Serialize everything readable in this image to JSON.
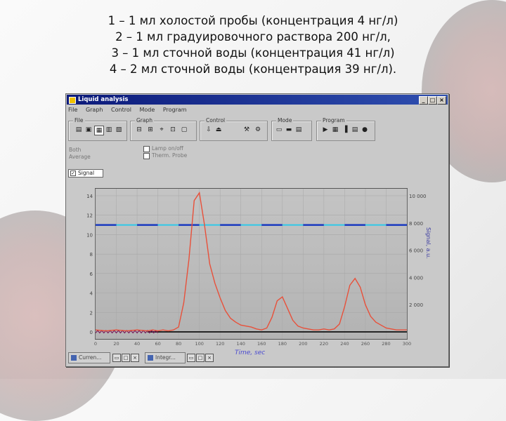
{
  "caption": [
    "1 – 1 мл холостой пробы (концентрация 4 нг/л)",
    "2 – 1 мл градуировочного раствора 200 нг/л,",
    "3 – 1 мл сточной воды (концентрация 41 нг/л)",
    "4 – 2 мл сточной воды (концентрация 39 нг/л)."
  ],
  "window": {
    "title": "Liquid analysis",
    "buttons": {
      "minimize": "_",
      "maximize": "□",
      "close": "×"
    },
    "menu": [
      "File",
      "Graph",
      "Control",
      "Mode",
      "Program"
    ],
    "toolbar_groups": {
      "file": "File",
      "graph": "Graph",
      "control": "Control",
      "mode": "Mode",
      "program": "Program"
    },
    "info_left": [
      "Both",
      "Average"
    ],
    "info_checks": [
      "Lamp on/off",
      "Therm. Probe"
    ],
    "series_select": "Signal"
  },
  "taskbar": [
    "Curren...",
    "Integr..."
  ],
  "chart_data": {
    "type": "line",
    "xlabel": "Time, sec",
    "ylabel_right": "Signal, a.u.",
    "x_ticks": [
      0,
      20,
      40,
      60,
      80,
      100,
      120,
      140,
      160,
      180,
      200,
      220,
      240,
      260,
      280,
      300
    ],
    "xlim": [
      0,
      300
    ],
    "y_left_ticks": [
      0,
      2,
      4,
      6,
      8,
      10,
      12,
      14
    ],
    "y_left_range": [
      0,
      14
    ],
    "y_right_ticks": [
      "2 000",
      "4 000",
      "6 000",
      "8 000",
      "10 000"
    ],
    "series": [
      {
        "color": "#e8503a",
        "x": [
          0,
          10,
          20,
          30,
          40,
          50,
          55,
          60,
          65,
          70,
          75,
          80,
          85,
          90,
          95,
          100,
          105,
          110,
          115,
          120,
          125,
          130,
          135,
          140,
          145,
          150,
          155,
          160,
          165,
          170,
          175,
          180,
          185,
          190,
          195,
          200,
          205,
          210,
          215,
          220,
          225,
          230,
          235,
          240,
          245,
          250,
          255,
          260,
          265,
          270,
          275,
          280,
          285,
          290,
          295,
          300
        ],
        "y": [
          0.2,
          0.1,
          0.2,
          0.1,
          0.2,
          0.1,
          0.2,
          0.1,
          0.2,
          0.1,
          0.2,
          0.5,
          3.0,
          7.5,
          13.5,
          14.3,
          11.0,
          7.0,
          5.0,
          3.5,
          2.2,
          1.4,
          1.0,
          0.7,
          0.6,
          0.5,
          0.3,
          0.2,
          0.4,
          1.5,
          3.2,
          3.6,
          2.4,
          1.2,
          0.6,
          0.4,
          0.3,
          0.2,
          0.2,
          0.3,
          0.2,
          0.3,
          0.8,
          2.6,
          4.8,
          5.5,
          4.6,
          2.8,
          1.6,
          1.0,
          0.7,
          0.4,
          0.3,
          0.2,
          0.2,
          0.2
        ]
      }
    ],
    "baseline_color": "#7a1a5a",
    "reference_line_color_dash": "#1a3ac0",
    "reference_line_color_gap": "#30c8e8",
    "reference_level": 11.0
  }
}
